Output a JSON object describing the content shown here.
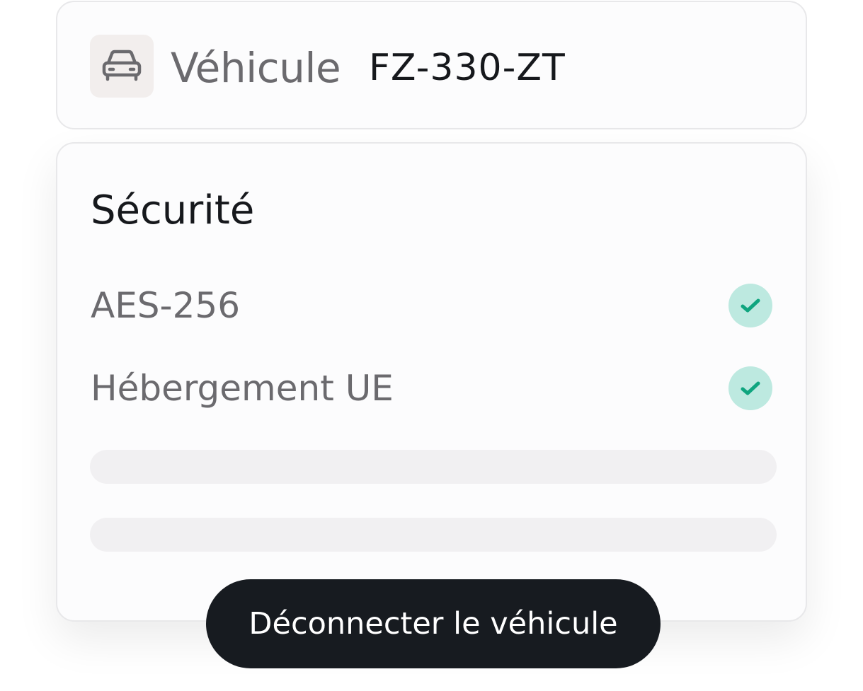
{
  "vehicle": {
    "icon": "car-icon",
    "label": "Véhicule",
    "plate": "FZ-330-ZT"
  },
  "security": {
    "title": "Sécurité",
    "items": [
      {
        "label": "AES-256",
        "status": "check-icon",
        "checked": true
      },
      {
        "label": "Hébergement UE",
        "status": "check-icon",
        "checked": true
      }
    ],
    "placeholder_rows": 2
  },
  "actions": {
    "disconnect_label": "Déconnecter le véhicule"
  },
  "colors": {
    "check_bg": "#bde9e0",
    "check_mark": "#0fa57f",
    "button_bg": "#171b20",
    "icon_box_bg": "#f2eeed"
  }
}
